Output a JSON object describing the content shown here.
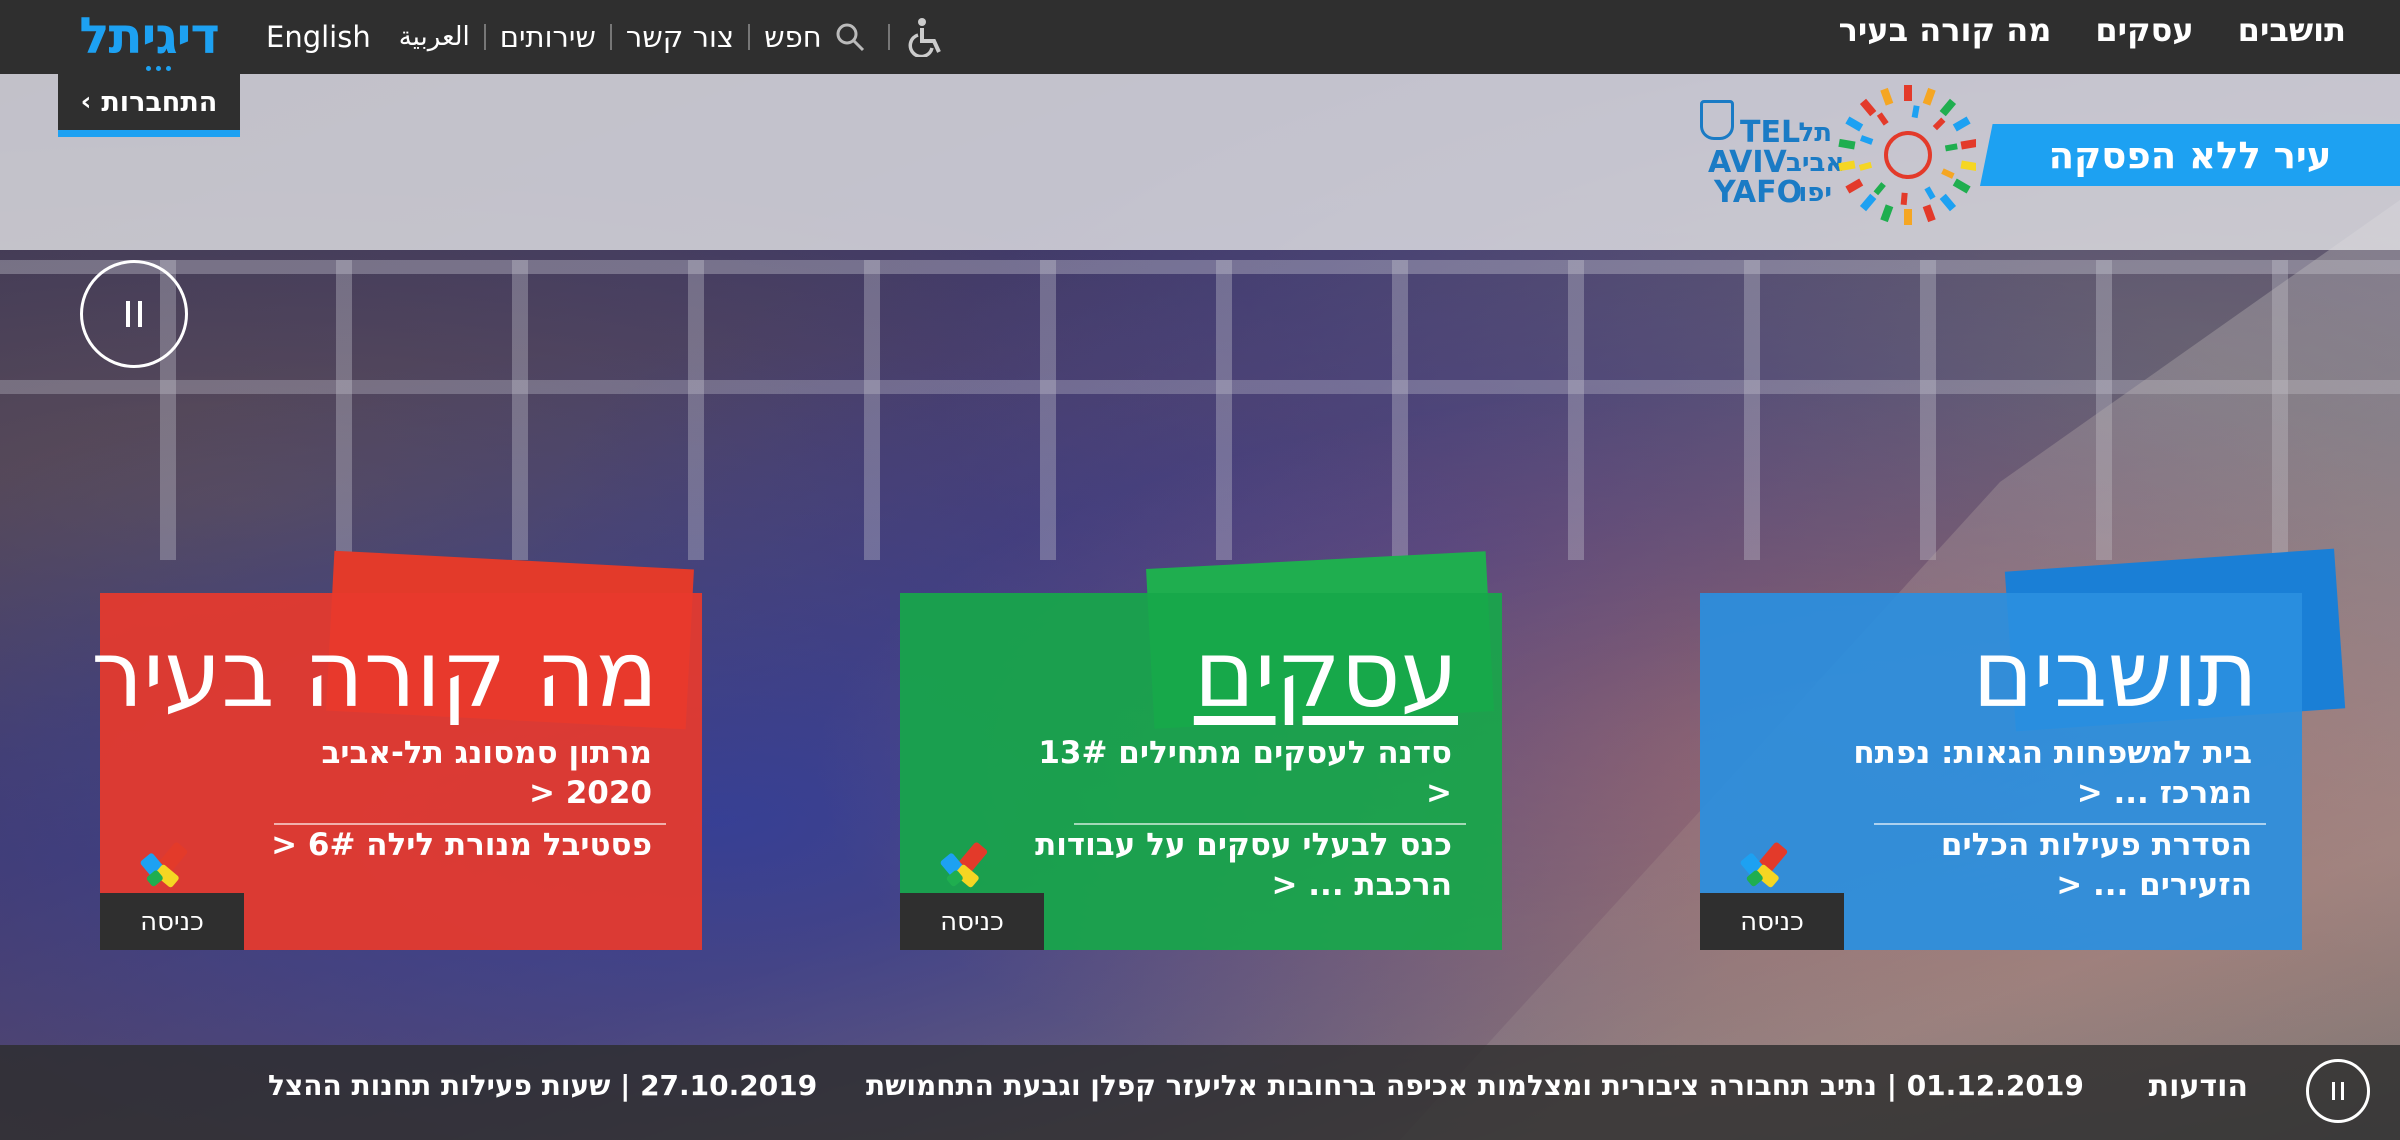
{
  "brand": {
    "logo_text": "דיגיתל",
    "login_label": "התחברות"
  },
  "util_nav": {
    "english": "English",
    "arabic": "العربية",
    "services": "שירותים",
    "contact": "צור קשר",
    "search": "חפש",
    "icons": [
      "search-icon",
      "accessibility-icon"
    ]
  },
  "main_nav": [
    {
      "label": "תושבים"
    },
    {
      "label": "עסקים"
    },
    {
      "label": "מה קורה בעיר"
    }
  ],
  "header": {
    "slogan": "עיר ללא הפסקה",
    "city_logo": {
      "latin_line1": "TEL",
      "latin_line2": "AVIV",
      "latin_line3": "YAFO",
      "hebrew_line1": "תל",
      "hebrew_line2": "אביב",
      "hebrew_line3": "יפו"
    }
  },
  "cards": [
    {
      "title": "מה קורה בעיר",
      "color": "#e8392d",
      "flag_color": "#e33a2a",
      "links": [
        "מרתון סמסונג תל-אביב 2020 <",
        "פסטיבל מנורת לילה 6# <"
      ],
      "enter_label": "כניסה"
    },
    {
      "title": "עסקים",
      "color": "#17a74a",
      "flag_color": "#1fae4f",
      "links": [
        "סדנה לעסקים מתחילים 13# <",
        "כנס לבעלי עסקים על עבודות הרכבת ... <"
      ],
      "enter_label": "כניסה"
    },
    {
      "title": "תושבים",
      "color": "#2a8fe0",
      "flag_color": "#1a7fd6",
      "links": [
        "בית למשפחות הגאות: נפתח המרכז ... <",
        "הסדרת פעילות הכלים הזעירים ... <"
      ],
      "enter_label": "כניסה"
    }
  ],
  "ticker": {
    "label": "הודעות",
    "items": [
      "01.12.2019 | נתיב תחבורה ציבורית ומצלמות אכיפה ברחובות אליעזר קפלן וגבעת התחמושת",
      "27.10.2019 | שעות פעילות תחנות ההצל"
    ]
  },
  "colors": {
    "accent": "#1da1f2",
    "topbar": "#2f2f2f"
  }
}
